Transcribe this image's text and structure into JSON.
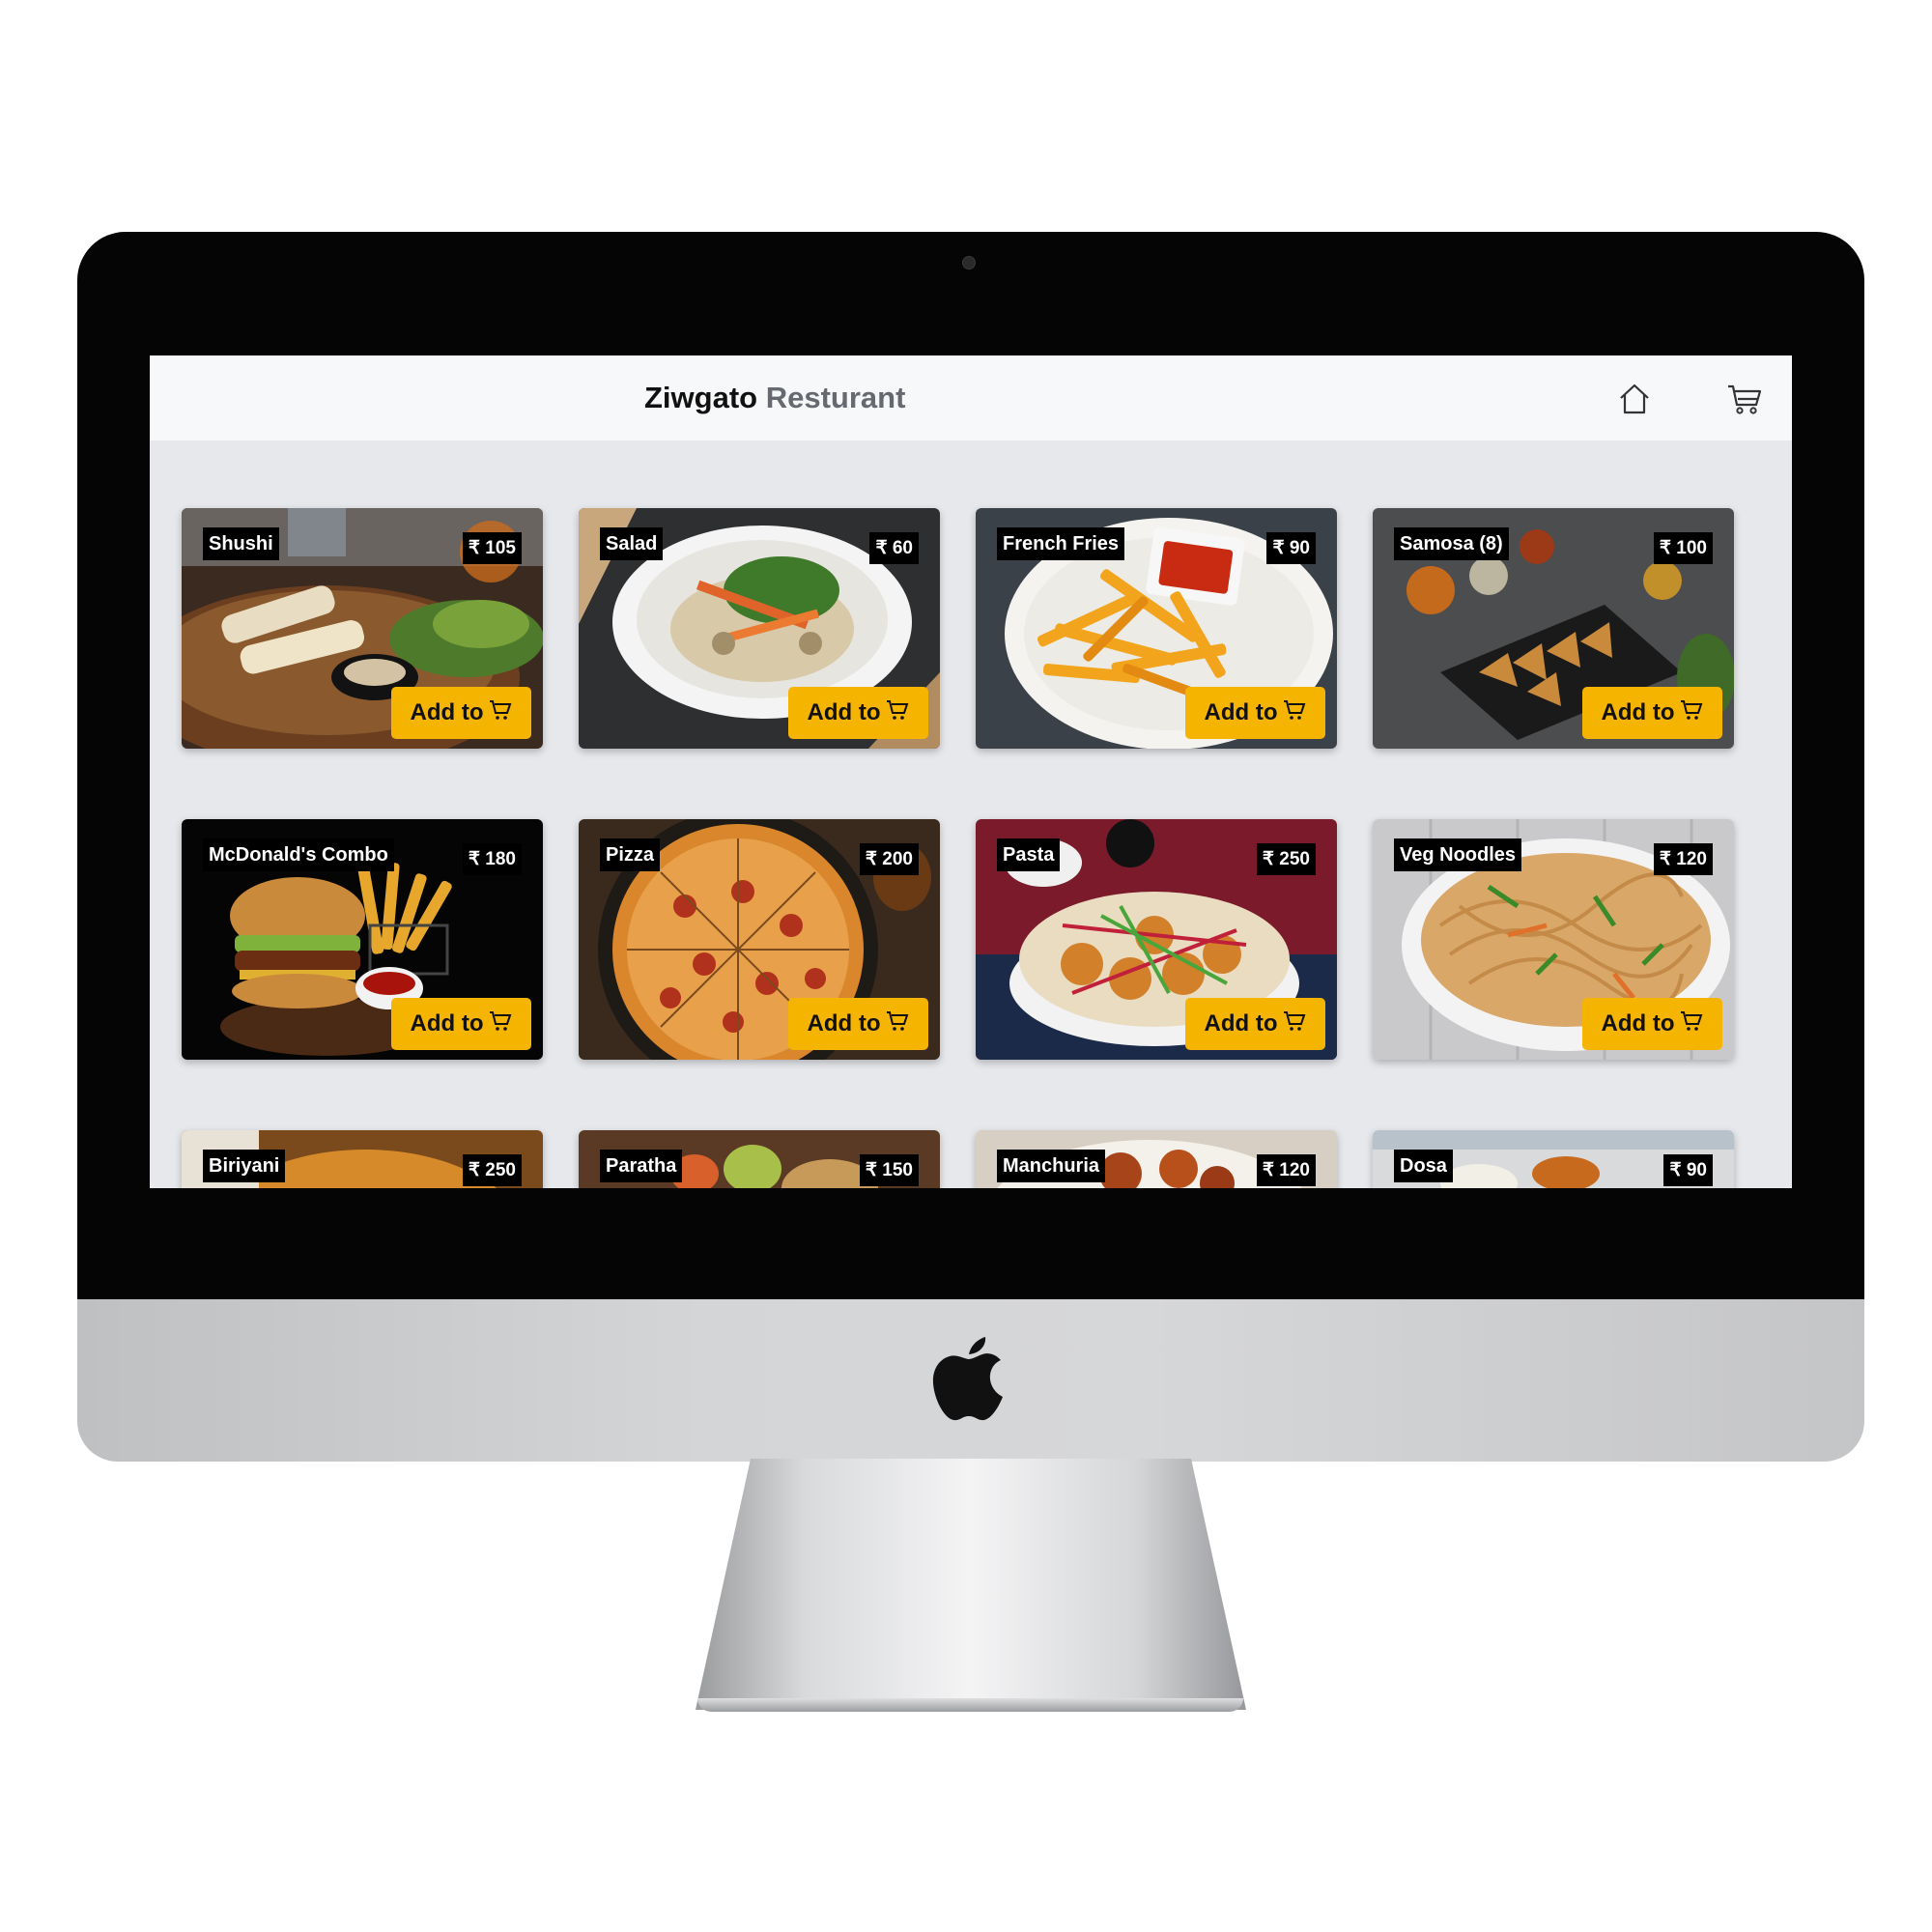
{
  "app": {
    "brand_main": "Ziwgato",
    "brand_sub": "Resturant"
  },
  "nav": {
    "home_icon": "home-icon",
    "cart_icon": "cart-icon"
  },
  "colors": {
    "accent": "#f5b400",
    "tag_bg": "#000000",
    "screen_bg": "#e6e8ec"
  },
  "menu": {
    "add_label": "Add to",
    "add_icon": "cart-icon",
    "items": [
      {
        "name": "Shushi",
        "price": "₹ 105"
      },
      {
        "name": "Salad",
        "price": "₹ 60"
      },
      {
        "name": "French Fries",
        "price": "₹ 90"
      },
      {
        "name": "Samosa (8)",
        "price": "₹ 100"
      },
      {
        "name": "McDonald's Combo",
        "price": "₹ 180"
      },
      {
        "name": "Pizza",
        "price": "₹ 200"
      },
      {
        "name": "Pasta",
        "price": "₹ 250"
      },
      {
        "name": "Veg Noodles",
        "price": "₹ 120"
      },
      {
        "name": "Biriyani",
        "price": "₹ 250"
      },
      {
        "name": "Paratha",
        "price": "₹ 150"
      },
      {
        "name": "Manchuria",
        "price": "₹ 120"
      },
      {
        "name": "Dosa",
        "price": "₹ 90"
      }
    ]
  }
}
